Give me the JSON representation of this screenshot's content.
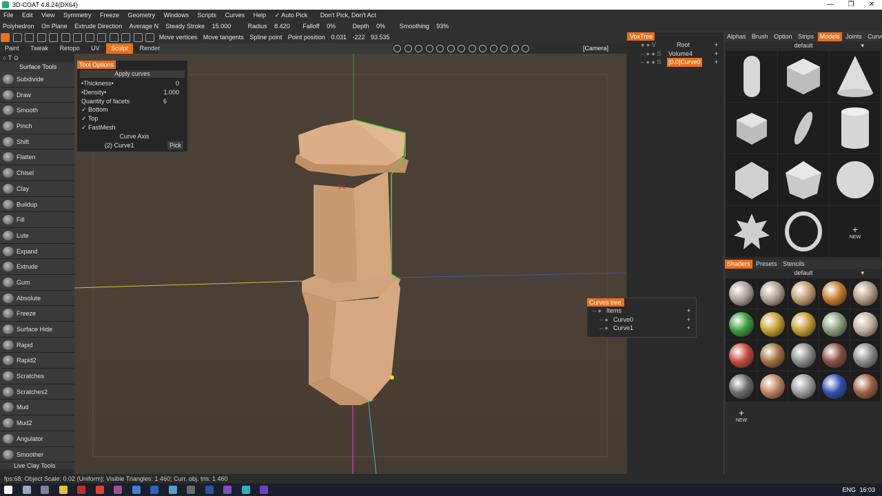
{
  "window": {
    "title": "3D-COAT 4.8.24(DX64)"
  },
  "menu": [
    "File",
    "Edit",
    "View",
    "Symmetry",
    "Freeze",
    "Geometry",
    "Windows",
    "Scripts",
    "Curves",
    "Help",
    "✓ Auto Pick",
    "Don't Pick, Don't Act"
  ],
  "toolbar1": {
    "mode": "Polyhedron",
    "on_plane": "On Plane",
    "extrude_dir": "Extrude Direction",
    "average": "Average N",
    "steady": "Steady Stroke",
    "steady_val": "15.000",
    "radius": "Radius",
    "radius_val": "8.420",
    "falloff": "Falloff",
    "falloff_val": "0%",
    "depth": "Depth",
    "depth_val": "0%",
    "smoothing": "Smoothing",
    "smoothing_val": "93%"
  },
  "toolbar2": {
    "move_vertices": "Move vertices",
    "move_tangents": "Move tangents",
    "spline_point": "Spline point",
    "point_position": "Point position",
    "x": "0.031",
    "y": "-222",
    "z": "93.535"
  },
  "rooms": [
    "Paint",
    "Tweak",
    "Retopo",
    "UV",
    "Sculpt",
    "Render"
  ],
  "active_room": "Sculpt",
  "camera_label": "[Camera]",
  "left_panel": {
    "title": "Surface Tools",
    "tools": [
      "Subdivide",
      "Draw",
      "Smooth",
      "Pinch",
      "Shift",
      "Flatten",
      "Chisel",
      "Clay",
      "Buildup",
      "Fill",
      "Lute",
      "Expand",
      "Extrude",
      "Gum",
      "Absolute",
      "Freeze",
      "Surface Hide",
      "Rapid",
      "Rapid2",
      "Scratches",
      "Scratches2",
      "Mud",
      "Mud2",
      "Angulator",
      "Smoother"
    ],
    "footer": "Live Clay Tools"
  },
  "tool_options": {
    "title": "Tool Options",
    "apply": "Apply curves",
    "thickness_label": "•Thickness•",
    "thickness": "0",
    "density_label": "•Density•",
    "density": "1.000",
    "facets_label": "Quantity of facets",
    "facets": "6",
    "bottom": "Bottom",
    "top": "Top",
    "fastmesh": "FastMesh",
    "axis": "Curve Axis",
    "axis_val": "(2) Curve1",
    "pick": "Pick"
  },
  "voxtree": {
    "title": "VoxTree",
    "root": "Root",
    "volume": "Volume4",
    "curve": "[0.0]Curve0"
  },
  "right_tabs": [
    "Alphas",
    "Brush",
    "Option",
    "Strips",
    "Models",
    "Joints",
    "Curves"
  ],
  "active_right_tab": "Models",
  "models_preset": "default",
  "new_label": "NEW",
  "shader_tabs": [
    "Shaders",
    "Presets",
    "Stencils"
  ],
  "shader_preset": "default",
  "shader_colors": [
    "#aaa29a",
    "#b0a090",
    "#c09a70",
    "#c77a2a",
    "#b49a80",
    "#3a9a3a",
    "#c7a030",
    "#c49a30",
    "#8a9a7a",
    "#c0b0a0",
    "#c44a3a",
    "#a07040",
    "#8a8a8a",
    "#8a5040",
    "#8a8a8a",
    "#6a6a6a",
    "#c08060",
    "#9a9a9a",
    "#3050b0",
    "#a06040"
  ],
  "curves_tree": {
    "title": "Curves tree",
    "items": "Items",
    "c0": "Curve0",
    "c1": "Curve1"
  },
  "status": "fps:68;     Object Scale: 0.02 (Uniform); Visible Triangles: 1 460; Curr. obj. tris: 1 460",
  "clock": "16:03",
  "lang": "ENG"
}
